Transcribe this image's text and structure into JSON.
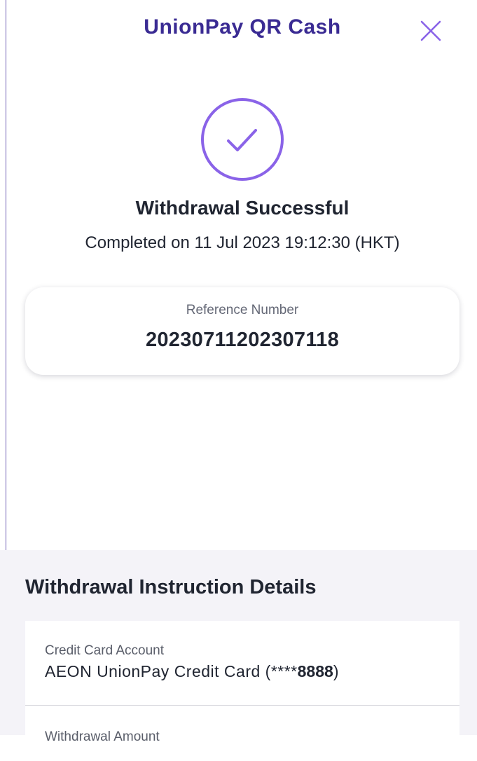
{
  "header": {
    "title": "UnionPay QR Cash",
    "close_icon": "close-icon"
  },
  "status": {
    "icon": "check-circle-icon",
    "title": "Withdrawal Successful",
    "subtitle": "Completed on 11 Jul 2023 19:12:30 (HKT)"
  },
  "reference": {
    "label": "Reference Number",
    "value": "20230711202307118"
  },
  "details": {
    "title": "Withdrawal Instruction Details",
    "credit_card": {
      "label": "Credit Card Account",
      "value_prefix": "AEON UnionPay Credit Card (****",
      "value_digits": "8888",
      "value_suffix": ")"
    },
    "withdrawal_amount": {
      "label": "Withdrawal Amount"
    }
  },
  "colors": {
    "accent": "#8a63e8",
    "brand": "#3a2b93",
    "text": "#202531",
    "details_background": "#f4f3f8"
  }
}
